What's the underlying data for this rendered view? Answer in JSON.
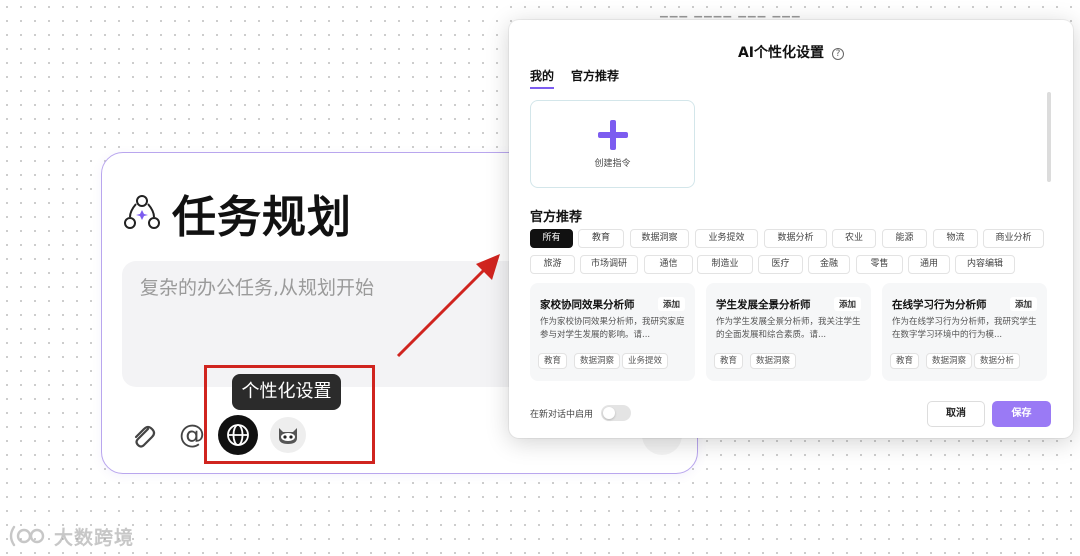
{
  "task_panel": {
    "title": "任务规划",
    "input_placeholder": "复杂的办公任务,从规划开始",
    "mention_symbol": "@",
    "icons": [
      "paperclip-icon",
      "at-icon",
      "globe-icon",
      "robot-mascot-icon"
    ]
  },
  "tooltip": {
    "text": "个性化设置"
  },
  "dialog": {
    "title": "AI个性化设置",
    "help_symbol": "?",
    "tabs": [
      {
        "label": "我的",
        "active": true
      },
      {
        "label": "官方推荐",
        "active": false
      }
    ],
    "create_label": "创建指令",
    "section_title": "官方推荐",
    "categories": [
      "所有",
      "教育",
      "数据洞察",
      "业务提效",
      "数据分析",
      "农业",
      "能源",
      "物流",
      "商业分析",
      "旅游",
      "市场调研",
      "通信",
      "制造业",
      "医疗",
      "金融",
      "零售",
      "通用",
      "内容编辑"
    ],
    "active_category": "所有",
    "cards": [
      {
        "name": "家校协同效果分析师",
        "add_label": "添加",
        "description": "作为家校协同效果分析师，我研究家庭参与对学生发展的影响。请...",
        "tags": [
          "教育",
          "数据洞察",
          "业务提效"
        ]
      },
      {
        "name": "学生发展全景分析师",
        "add_label": "添加",
        "description": "作为学生发展全景分析师，我关注学生的全面发展和综合素质。请...",
        "tags": [
          "教育",
          "数据洞察"
        ]
      },
      {
        "name": "在线学习行为分析师",
        "add_label": "添加",
        "description": "作为在线学习行为分析师，我研究学生在数字学习环境中的行为模...",
        "tags": [
          "教育",
          "数据洞察",
          "数据分析"
        ]
      }
    ],
    "toggle_label": "在新对话中启用",
    "toggle_on": false,
    "cancel_label": "取消",
    "save_label": "保存"
  },
  "watermark": {
    "text": "大数跨境"
  },
  "colors": {
    "accent": "#9a7af5",
    "plus": "#7c5cf0",
    "highlight": "#d0241f",
    "card_border": "#b9a6ee"
  }
}
